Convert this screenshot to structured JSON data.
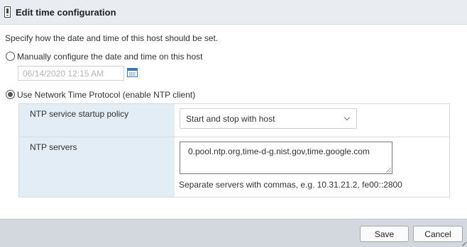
{
  "dialog": {
    "title": "Edit time configuration",
    "intro": "Specify how the date and time of this host should be set."
  },
  "manual": {
    "label": "Manually configure the date and time on this host",
    "selected": false,
    "date_placeholder": "06/14/2020 12:15 AM"
  },
  "ntp": {
    "label": "Use Network Time Protocol (enable NTP client)",
    "selected": true,
    "startup_policy_label": "NTP service startup policy",
    "startup_policy_value": "Start and stop with host",
    "servers_label": "NTP servers",
    "servers_value": "0.pool.ntp.org,time-d-g.nist.gov,time.google.com",
    "servers_hint": "Separate servers with commas, e.g. 10.31.21.2, fe00::2800"
  },
  "footer": {
    "save_label": "Save",
    "cancel_label": "Cancel"
  },
  "icons": {
    "title": "host-config-icon",
    "calendar": "calendar-icon",
    "dropdown": "chevron-down-icon"
  },
  "colors": {
    "titlebar_bg": "#e9edf1",
    "label_column_bg": "#e3edf5",
    "footer_bg": "#d3d8de",
    "calendar_accent": "#3a78b4"
  }
}
